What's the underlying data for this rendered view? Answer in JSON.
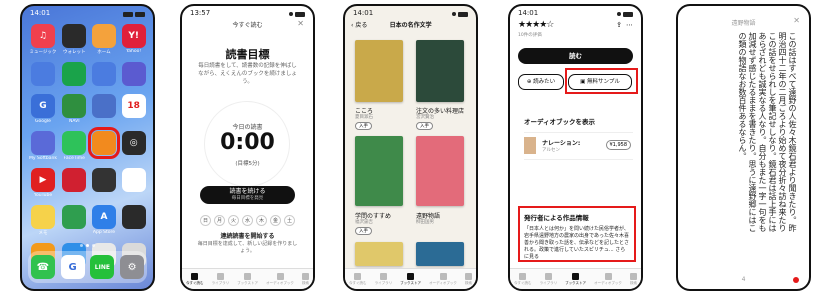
{
  "colors": {
    "highlight": "#e51a1a",
    "button_dark": "#111111"
  },
  "screen1": {
    "status": {
      "time": "14:01"
    },
    "apps": [
      {
        "label": "ミュージック",
        "color": "#f0404e",
        "icon": "music-icon",
        "glyph": "♫"
      },
      {
        "label": "ウォレット",
        "color": "#2a2a2a",
        "icon": "wallet-icon",
        "glyph": ""
      },
      {
        "label": "ホーム",
        "color": "#f4a23c",
        "icon": "home-icon",
        "glyph": ""
      },
      {
        "label": "Yahoo!",
        "color": "#e0203a",
        "icon": "yahoo-icon",
        "glyph": "Y!"
      },
      {
        "label": "",
        "color": "#4b7ce0",
        "icon": "app-icon",
        "glyph": ""
      },
      {
        "label": "",
        "color": "#1aa34a",
        "icon": "app-icon",
        "glyph": ""
      },
      {
        "label": "",
        "color": "#4b7ce0",
        "icon": "app-icon",
        "glyph": ""
      },
      {
        "label": "",
        "color": "#5b5bd0",
        "icon": "app-icon",
        "glyph": ""
      },
      {
        "label": "Google",
        "color": "#3a6fd8",
        "icon": "google-icon",
        "glyph": "G"
      },
      {
        "label": "NAVI",
        "color": "#2f8f3f",
        "icon": "navi-icon",
        "glyph": ""
      },
      {
        "label": "",
        "color": "#4a70c8",
        "icon": "app-icon",
        "glyph": ""
      },
      {
        "label": "",
        "color": "#ffffff",
        "icon": "calendar-icon",
        "glyph": "18"
      },
      {
        "label": "My Softbank",
        "color": "#5a6ad8",
        "icon": "softbank-icon",
        "glyph": ""
      },
      {
        "label": "FaceTime",
        "color": "#2ec25a",
        "icon": "facetime-icon",
        "glyph": ""
      },
      {
        "label": "",
        "color": "#f28a1e",
        "icon": "books-icon",
        "glyph": ""
      },
      {
        "label": "",
        "color": "#2a2a2a",
        "icon": "fitness-icon",
        "glyph": "◎"
      },
      {
        "label": "YouTube",
        "color": "#e02020",
        "icon": "youtube-icon",
        "glyph": "▶"
      },
      {
        "label": "",
        "color": "#d02030",
        "icon": "app-icon",
        "glyph": ""
      },
      {
        "label": "",
        "color": "#333333",
        "icon": "clock-icon",
        "glyph": ""
      },
      {
        "label": "",
        "color": "#ffffff",
        "icon": "app-icon",
        "glyph": ""
      },
      {
        "label": "メモ",
        "color": "#f6d24a",
        "icon": "notes-icon",
        "glyph": ""
      },
      {
        "label": "",
        "color": "#2f9e4f",
        "icon": "app-icon",
        "glyph": ""
      },
      {
        "label": "App Store",
        "color": "#2f7fe8",
        "icon": "appstore-icon",
        "glyph": "A"
      },
      {
        "label": "",
        "color": "#2a2a2a",
        "icon": "app-icon",
        "glyph": ""
      },
      {
        "label": "",
        "color": "#f39a1c",
        "icon": "app-icon",
        "glyph": ""
      },
      {
        "label": "",
        "color": "#2f8fe8",
        "icon": "app-icon",
        "glyph": ""
      },
      {
        "label": "",
        "color": "#e8e8e8",
        "icon": "app-icon",
        "glyph": ""
      },
      {
        "label": "",
        "color": "#dadada",
        "icon": "app-icon",
        "glyph": ""
      }
    ],
    "dock": [
      {
        "icon": "phone-icon",
        "color": "#31c24f",
        "glyph": "☎"
      },
      {
        "icon": "google-icon",
        "color": "#ffffff",
        "glyph": "G"
      },
      {
        "icon": "line-icon",
        "color": "#25c03a",
        "glyph": "LINE"
      },
      {
        "icon": "settings-icon",
        "color": "#8e8e93",
        "glyph": "⚙"
      }
    ]
  },
  "screen2": {
    "status": {
      "time": "13:57"
    },
    "header": "今すぐ読む",
    "title": "読書目標",
    "description": "毎日読書をして、読書数の記録を伸ばしながら、えくえんのブックを続けましょう。",
    "today_label": "今日の読書",
    "time_value": "0:00",
    "goal": "(目標5分)",
    "button_label": "読書を続ける",
    "button_sub": "毎日目標を発見",
    "days": [
      "日",
      "月",
      "火",
      "水",
      "木",
      "金",
      "土"
    ],
    "streak_title": "連続読書を開始する",
    "streak_sub": "毎日目標を達成して、新しい記録を作りましょう。",
    "tabs": [
      "今すぐ読む",
      "ライブラリ",
      "ブックストア",
      "オーディオブック",
      "検索"
    ]
  },
  "screen3": {
    "status": {
      "time": "14:01"
    },
    "back": "戻る",
    "title": "日本の名作文学",
    "books": [
      {
        "title": "こころ",
        "author": "夏目漱石",
        "get": "入手"
      },
      {
        "title": "注文の多い料理店",
        "author": "宮沢賢治",
        "get": "入手"
      },
      {
        "title": "学問のすすめ",
        "author": "福沢諭吉",
        "get": "入手"
      },
      {
        "title": "遠野物語",
        "author": "柳田国男",
        "get": ""
      }
    ]
  },
  "screen4": {
    "status": {
      "time": "14:01"
    },
    "stars": "★★★★☆",
    "rating_count": "10件の評価",
    "read_button": "読む",
    "wish_button": "読みたい",
    "sample_button": "無料サンプル",
    "audio_heading": "オーディオブックを表示",
    "narration": "ナレーション:",
    "narrator": "アルセン",
    "price": "¥1,958",
    "pub_heading": "発行者による作品情報",
    "pub_text": "「日本人とは何か」を問い続けた民俗学者が、岩手県遠野地方の農家の出身であった佐々木喜善から聞き取った話を、伝承などを記したとされる。政策で進行していたスピリチュ... さらに見る"
  },
  "screen5": {
    "title": "遠野物語",
    "body": "この話はすべて遠野の人佐々木鏡石君より聞きたり。昨明治四十二年の二月ごろより始めて夜分折々訪ね来たりこの話をせられしを筆記せしなり。鏡石君は話上手にはあらざれども誠実なる人なり。自分もまた一字一句をも加減せず感じたるままを書きたり。思うに遠野郷にはこの類の物語なお数百件あるならん。",
    "page": "4"
  }
}
